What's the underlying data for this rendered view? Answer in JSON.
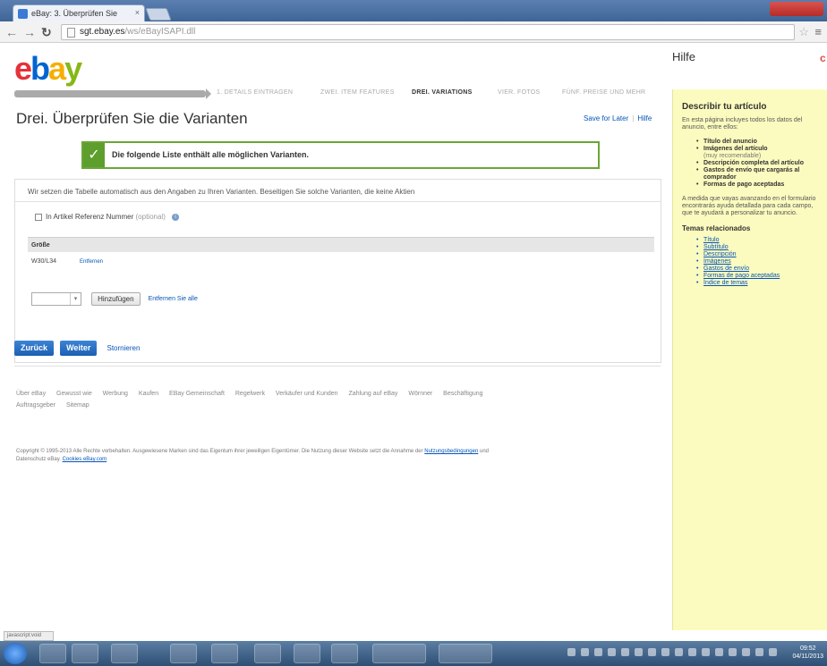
{
  "browser": {
    "tab_title": "eBay: 3. Überprüfen Sie",
    "tab_close": "×",
    "url_host": "sgt.ebay.es",
    "url_path": "/ws/eBayISAPI.dll"
  },
  "logo": {
    "e": "e",
    "b": "b",
    "a": "a",
    "y": "y"
  },
  "steps": [
    "1. DETAILS EINTRAGEN",
    "ZWEI. ITEM FEATURES",
    "DREI. VARIATIONS",
    "VIER. FOTOS",
    "FÜNF. PREISE UND MEHR"
  ],
  "page": {
    "title": "Drei. Überprüfen Sie die Varianten",
    "save_for_later": "Save for Later",
    "help_link": "Hilfe",
    "success_message": "Die folgende Liste enthält alle möglichen Varianten.",
    "intro": "Wir setzen die Tabelle automatisch aus den Angaben zu Ihren Varianten. Beseitigen Sie solche Varianten, die keine Aktien",
    "ref_label": "In Artikel Referenz Nummer",
    "ref_optional": "(optional)",
    "info_icon": "i",
    "table_header": "Größe",
    "rows": [
      {
        "value": "W30/L34",
        "remove": "Entfernen"
      }
    ],
    "select_arrow": "▾",
    "add_button": "Hinzufügen",
    "remove_all": "Entfernen Sie alle",
    "back_button": "Zurück",
    "next_button": "Weiter",
    "cancel": "Stornieren"
  },
  "footer": {
    "links": [
      "Über eBay",
      "Gewusst wie",
      "Werbung",
      "Kaufen",
      "EBay Gemeinschaft",
      "Regelwerk",
      "Verkäufer und Kunden",
      "Zahlung auf eBay",
      "Wörnner",
      "Beschäftigung",
      "Auftragsgeber",
      "Sitemap"
    ],
    "copyright_text": "Copyright © 1995-2013 Alle Rechte vorbehalten. Ausgewiesene Marken sind das Eigentum ihrer jeweiligen Eigentümer. Die Nutzung dieser Website setzt die Annahme der",
    "copyright_link1": "Nutzungsbedingungen",
    "copyright_and": "und",
    "copyright_line2_pre": "Datenschutz eBay.",
    "copyright_link2": "Cookies eBay.com"
  },
  "help": {
    "header": "Hilfe",
    "close": "c",
    "title": "Describir tu artículo",
    "intro": "En esta página incluyes todos los datos del anuncio, entre ellos:",
    "items": [
      {
        "label": "Título del anuncio",
        "sub": ""
      },
      {
        "label": "Imágenes del artículo",
        "sub": "(muy recomendable)"
      },
      {
        "label": "Descripción completa del artículo",
        "sub": ""
      },
      {
        "label": "Gastos de envío que cargarás al comprador",
        "sub": ""
      },
      {
        "label": "Formas de pago aceptadas",
        "sub": ""
      }
    ],
    "paragraph": "A medida que vayas avanzando en el formulario encontrarás ayuda detallada para cada campo, que te ayudará a personalizar tu anuncio.",
    "topics_title": "Temas relacionados",
    "topics": [
      "Título",
      "Subtítulo",
      "Descripción",
      "Imágenes",
      "Gastos de envío",
      "Formas de pago aceptadas",
      "Índice de temas"
    ]
  },
  "status_text": "javascript:void",
  "clock": {
    "time": "09:52",
    "date": "04/11/2013"
  }
}
